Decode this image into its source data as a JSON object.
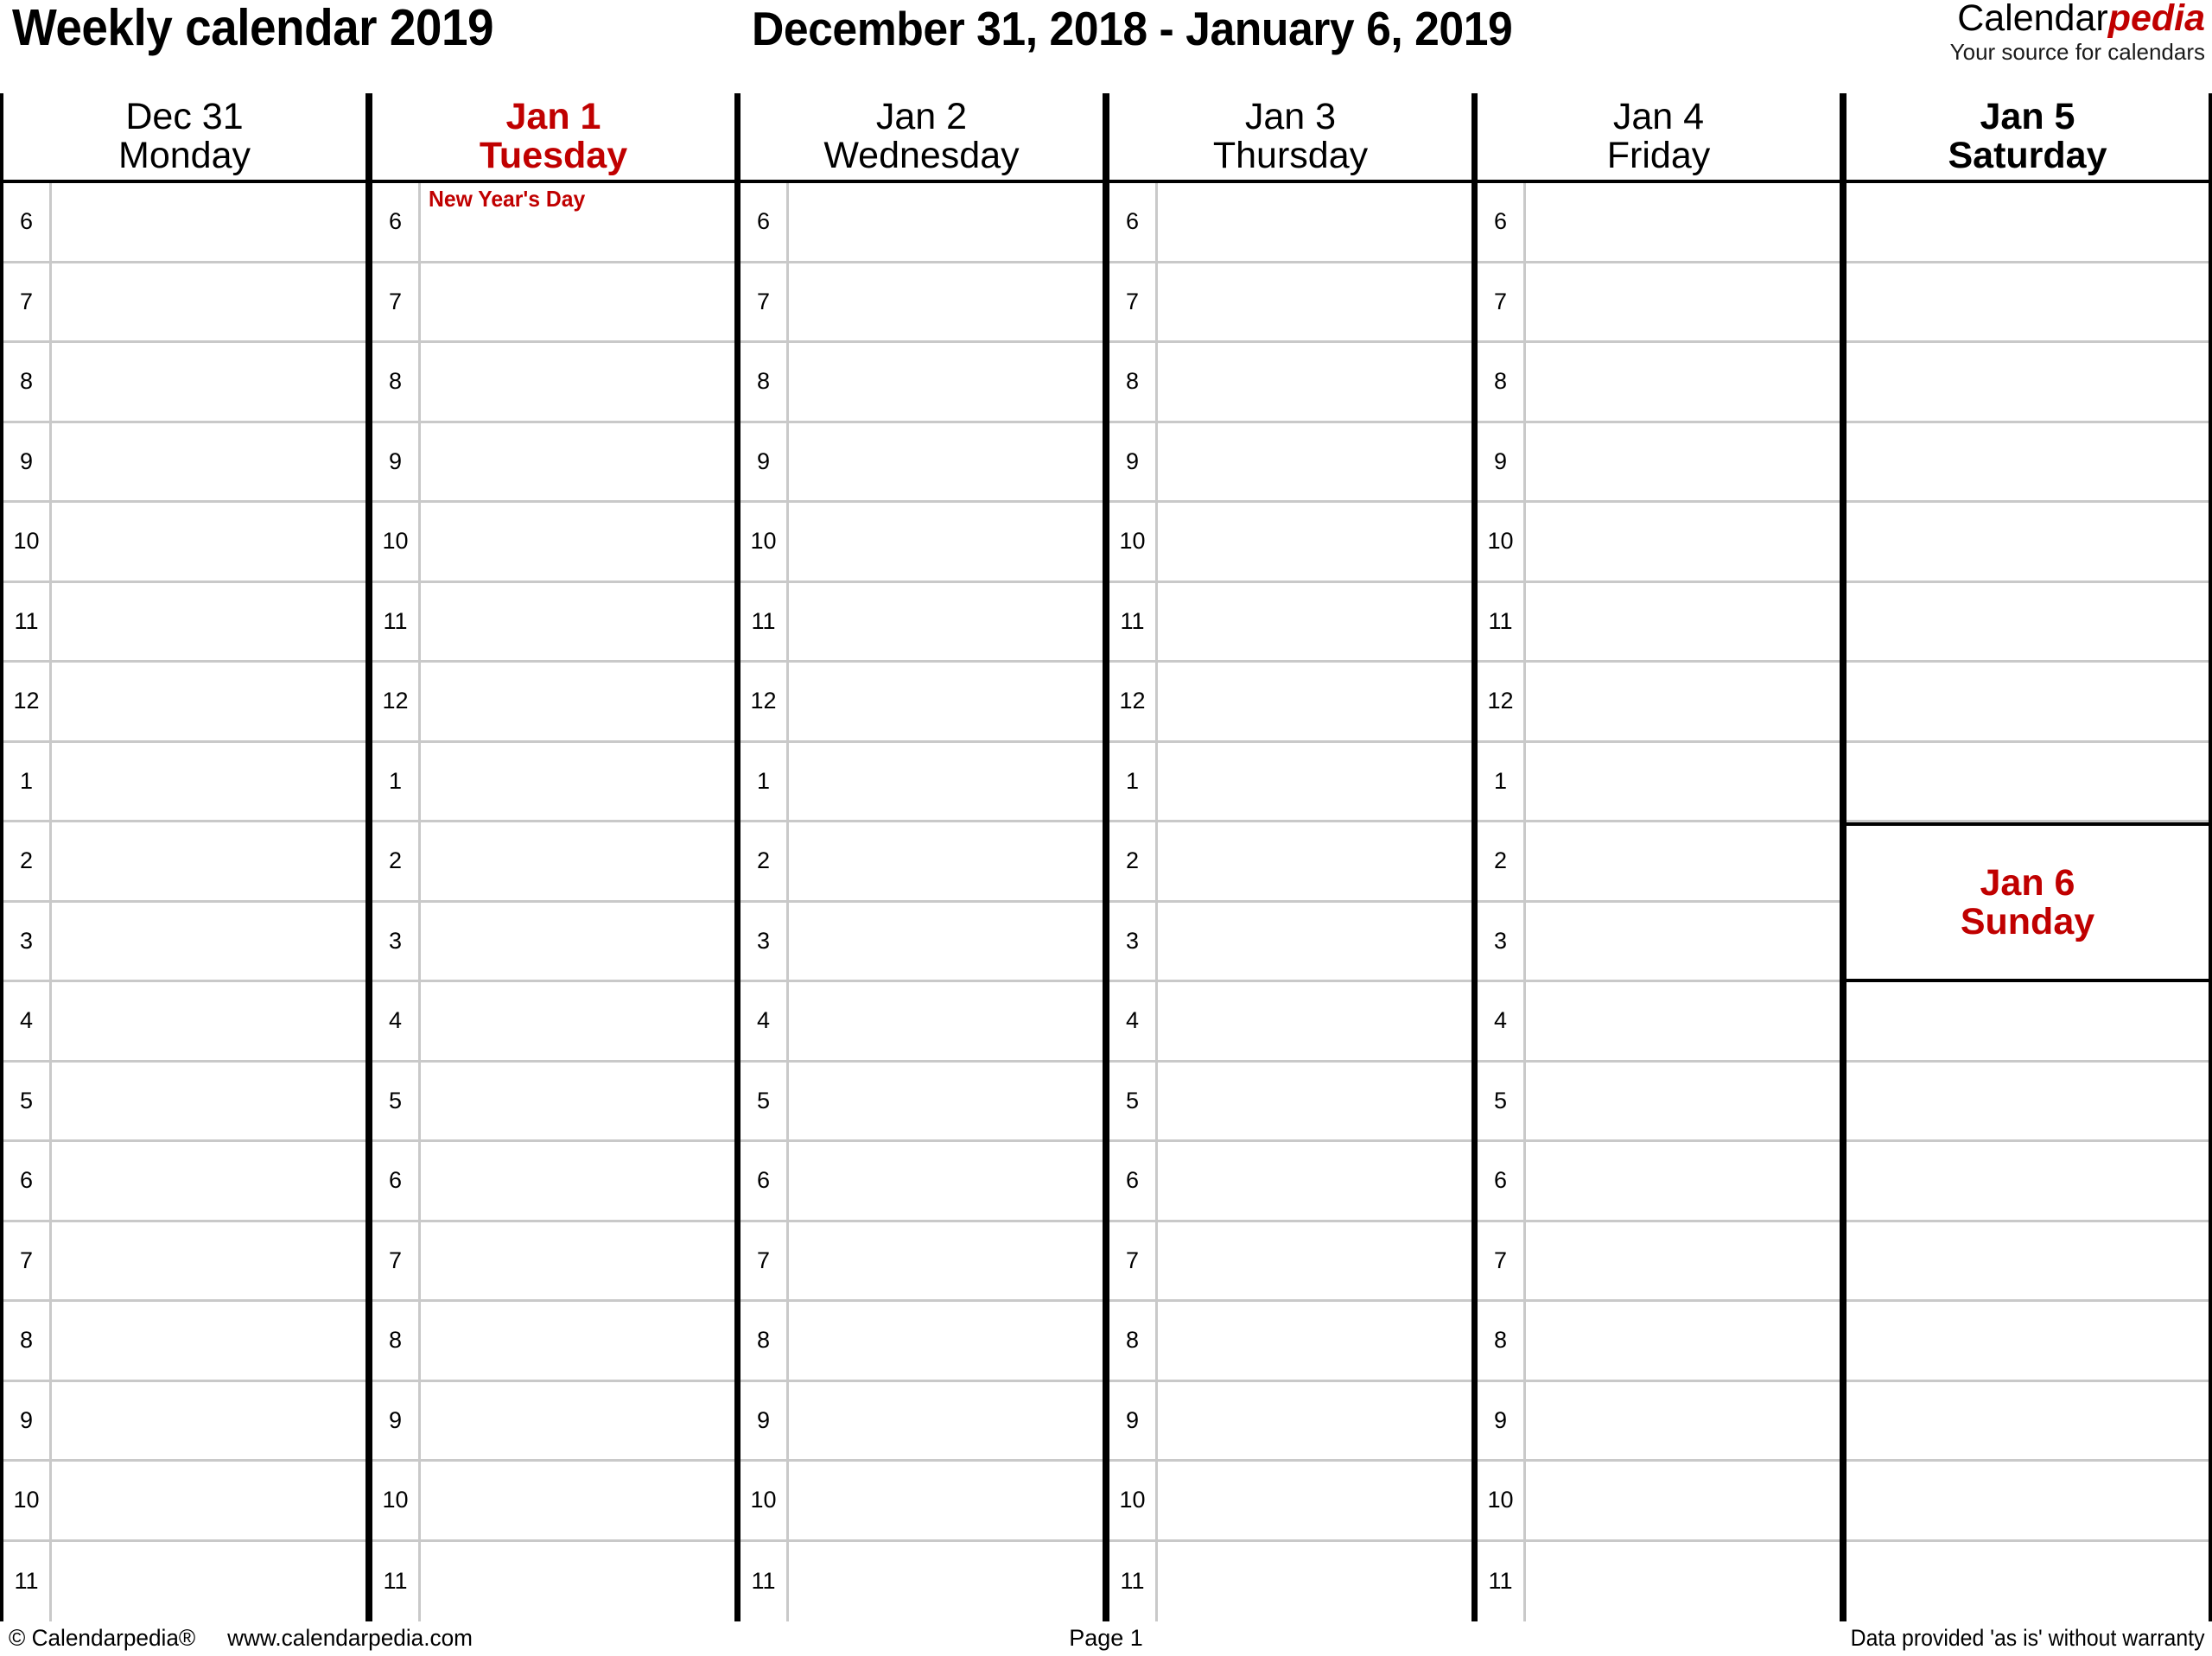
{
  "header": {
    "title": "Weekly calendar 2019",
    "date_range": "December 31, 2018 - January 6, 2019",
    "logo": {
      "brand_first": "Calendar",
      "brand_second": "pedia",
      "tagline": "Your source for calendars",
      "accent_color": "#C00000"
    }
  },
  "columns": [
    {
      "id": "monday",
      "date": "Dec 31",
      "weekday": "Monday",
      "style": "plain",
      "has_hour_column": true,
      "hours": [
        "6",
        "7",
        "8",
        "9",
        "10",
        "11",
        "12",
        "1",
        "2",
        "3",
        "4",
        "5",
        "6",
        "7",
        "8",
        "9",
        "10",
        "11"
      ],
      "events": []
    },
    {
      "id": "tuesday",
      "date": "Jan 1",
      "weekday": "Tuesday",
      "style": "red",
      "has_hour_column": true,
      "hours": [
        "6",
        "7",
        "8",
        "9",
        "10",
        "11",
        "12",
        "1",
        "2",
        "3",
        "4",
        "5",
        "6",
        "7",
        "8",
        "9",
        "10",
        "11"
      ],
      "events": [
        {
          "slot_index": 0,
          "label": "New Year's Day",
          "color": "#C00000"
        }
      ]
    },
    {
      "id": "wednesday",
      "date": "Jan 2",
      "weekday": "Wednesday",
      "style": "plain",
      "has_hour_column": true,
      "hours": [
        "6",
        "7",
        "8",
        "9",
        "10",
        "11",
        "12",
        "1",
        "2",
        "3",
        "4",
        "5",
        "6",
        "7",
        "8",
        "9",
        "10",
        "11"
      ],
      "events": []
    },
    {
      "id": "thursday",
      "date": "Jan 3",
      "weekday": "Thursday",
      "style": "plain",
      "has_hour_column": true,
      "hours": [
        "6",
        "7",
        "8",
        "9",
        "10",
        "11",
        "12",
        "1",
        "2",
        "3",
        "4",
        "5",
        "6",
        "7",
        "8",
        "9",
        "10",
        "11"
      ],
      "events": []
    },
    {
      "id": "friday",
      "date": "Jan 4",
      "weekday": "Friday",
      "style": "plain",
      "has_hour_column": true,
      "hours": [
        "6",
        "7",
        "8",
        "9",
        "10",
        "11",
        "12",
        "1",
        "2",
        "3",
        "4",
        "5",
        "6",
        "7",
        "8",
        "9",
        "10",
        "11"
      ],
      "events": []
    }
  ],
  "weekend_column": {
    "saturday": {
      "id": "saturday",
      "date": "Jan 5",
      "weekday": "Saturday",
      "style": "boldblack"
    },
    "sunday": {
      "id": "sunday",
      "date": "Jan 6",
      "weekday": "Sunday",
      "style": "red"
    },
    "saturday_slot_count": 8,
    "sunday_slot_count": 8
  },
  "footer": {
    "copyright": "© Calendarpedia®",
    "website": "www.calendarpedia.com",
    "page": "Page 1",
    "disclaimer": "Data provided 'as is' without warranty"
  }
}
